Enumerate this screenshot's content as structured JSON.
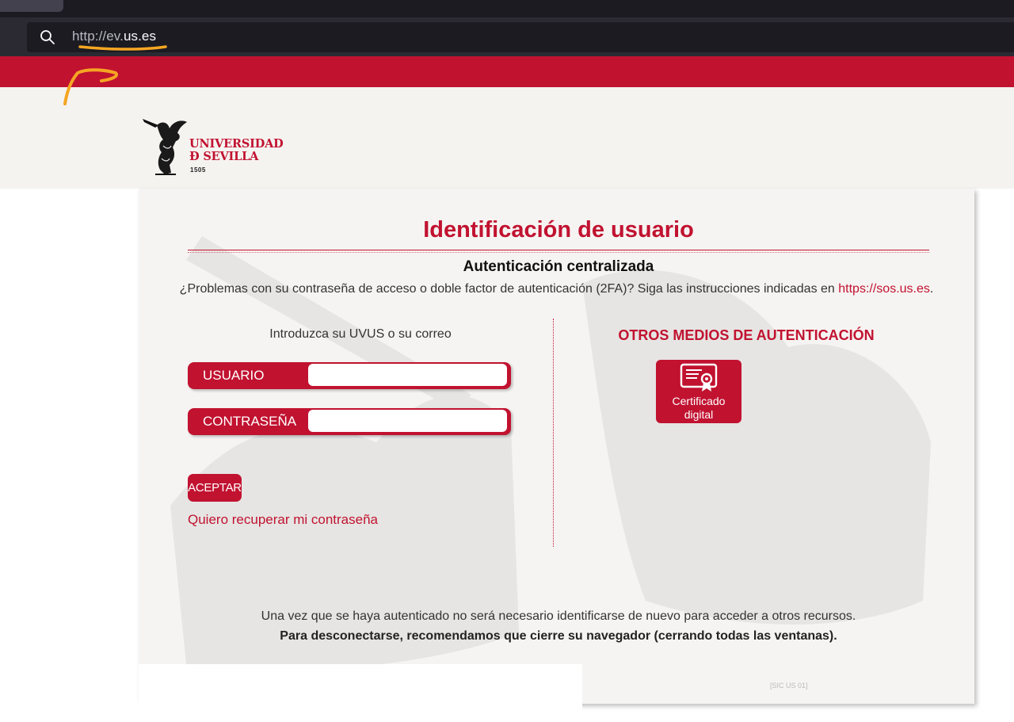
{
  "browser": {
    "url_scheme": "http://ev.",
    "url_domain": "us.es",
    "colors": {
      "chrome_bg": "#2b2a33",
      "urlbar_bg": "#1c1b22",
      "annotation": "#f5a623"
    }
  },
  "site": {
    "logo": {
      "line1": "UNIVERSIDAD",
      "line2": "Ð SEVILLA",
      "year": "1505"
    },
    "accent_color": "#c11230"
  },
  "login": {
    "title": "Identificación de usuario",
    "subtitle": "Autenticación centralizada",
    "help_text": "¿Problemas con su contraseña de acceso o doble factor de autenticación (2FA)? Siga las instrucciones indicadas en ",
    "help_link": "https://sos.us.es",
    "help_end": ".",
    "intro": "Introduzca su UVUS o su correo",
    "username_label": "USUARIO",
    "username_value": "",
    "password_label": "CONTRASEÑA",
    "password_value": "",
    "accept_label": "ACEPTAR",
    "recover_link": "Quiero recuperar mi contraseña"
  },
  "other_methods": {
    "title": "OTROS MEDIOS DE AUTENTICACIÓN",
    "cert_line1": "Certificado",
    "cert_line2": "digital",
    "cert_icon": "certificate-icon"
  },
  "footer": {
    "note1": "Una vez que se haya autenticado no será necesario identificarse de nuevo para acceder a otros recursos.",
    "note2": "Para desconectarse, recomendamos que cierre su navegador (cerrando todas las ventanas).",
    "code": "[SIC US 01]"
  }
}
